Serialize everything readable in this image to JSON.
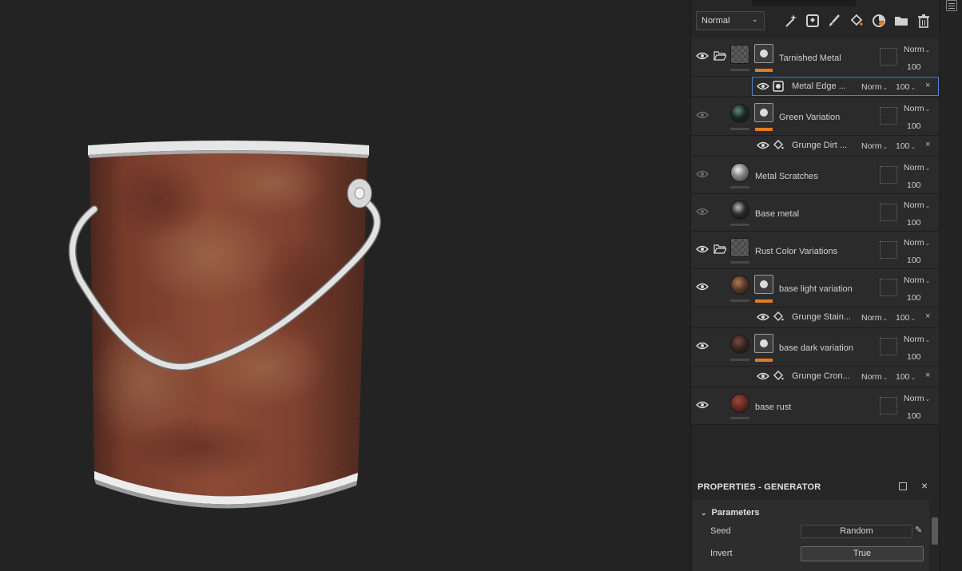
{
  "toolbar": {
    "blend_mode": "Normal",
    "icons": [
      "magic-wand-icon",
      "generator-icon",
      "brush-icon",
      "fill-icon",
      "color-icon",
      "folder-icon",
      "trash-icon"
    ]
  },
  "layers": [
    {
      "name": "Tarnished Metal",
      "blend": "Norm",
      "opacity": "100",
      "visible": true,
      "folder": true,
      "thumb": "checker",
      "has_mask": true
    },
    {
      "name": "Metal Edge ...",
      "blend": "Norm",
      "opacity": "100",
      "sub": true,
      "icon": "generator-icon",
      "selected": true
    },
    {
      "name": "Green Variation",
      "blend": "Norm",
      "opacity": "100",
      "visible": false,
      "thumb": "#1a2a24",
      "has_mask": true
    },
    {
      "name": "Grunge Dirt ...",
      "blend": "Norm",
      "opacity": "100",
      "sub": true,
      "icon": "fill-icon"
    },
    {
      "name": "Metal Scratches",
      "blend": "Norm",
      "opacity": "100",
      "visible": false,
      "thumb": "#8a8a8a"
    },
    {
      "name": "Base metal",
      "blend": "Norm",
      "opacity": "100",
      "visible": false,
      "thumb": "#2a2a2a"
    },
    {
      "name": "Rust Color Variations",
      "blend": "Norm",
      "opacity": "100",
      "visible": true,
      "folder": true,
      "thumb": "checker"
    },
    {
      "name": "base light variation",
      "blend": "Norm",
      "opacity": "100",
      "visible": true,
      "thumb": "#5a3a2a",
      "has_mask": true
    },
    {
      "name": "Grunge Stain...",
      "blend": "Norm",
      "opacity": "100",
      "sub": true,
      "icon": "fill-icon"
    },
    {
      "name": "base dark variation",
      "blend": "Norm",
      "opacity": "100",
      "visible": true,
      "thumb": "#3a2622",
      "has_mask": true
    },
    {
      "name": "Grunge Cron...",
      "blend": "Norm",
      "opacity": "100",
      "sub": true,
      "icon": "fill-icon"
    },
    {
      "name": "base rust",
      "blend": "Norm",
      "opacity": "100",
      "visible": true,
      "thumb": "#6a2a22"
    }
  ],
  "properties": {
    "title": "PROPERTIES - GENERATOR",
    "section": "Parameters",
    "seed_label": "Seed",
    "seed_value": "Random",
    "invert_label": "Invert",
    "invert_value": "True"
  },
  "colors": {
    "accent_orange": "#e57b20",
    "selection_blue": "#4d86c8",
    "rust": "#7a3a2a"
  }
}
